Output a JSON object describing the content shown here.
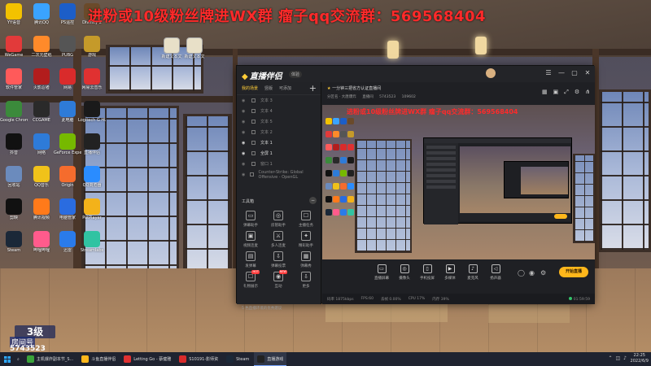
{
  "overlay_text": "进粉或10级粉丝牌进WX群  瘤子qq交流群：569568404",
  "fan_badge": {
    "level": "3级",
    "room_label": "房间号",
    "room_id": "5743523"
  },
  "desktop_icons": [
    {
      "label": "YY语音",
      "color": "#f3c200"
    },
    {
      "label": "腾讯QQ",
      "color": "#3aa3ff"
    },
    {
      "label": "PS遥控",
      "color": "#1c5ec8"
    },
    {
      "label": "Divinity 2",
      "color": "#6a4a2a"
    },
    {
      "label": "WeGame",
      "color": "#e23a3a"
    },
    {
      "label": "二次元壁纸",
      "color": "#ff8a2a"
    },
    {
      "label": "PUBG",
      "color": "#555"
    },
    {
      "label": "游戏",
      "color": "#c59a2a"
    },
    {
      "label": "软件管家",
      "color": "#ff5a5a"
    },
    {
      "label": "火影忍者",
      "color": "#b21d1d"
    },
    {
      "label": "网易",
      "color": "#d92b2b"
    },
    {
      "label": "网易云音乐",
      "color": "#e03131"
    },
    {
      "label": "Google Chrome",
      "color": "#3b8a3b"
    },
    {
      "label": "CCGAME",
      "color": "#2a2a2a"
    },
    {
      "label": "此电脑",
      "color": "#2e7bd8"
    },
    {
      "label": "Logitech G HUB",
      "color": "#1a1a1a"
    },
    {
      "label": "抖音",
      "color": "#111"
    },
    {
      "label": "网络",
      "color": "#2e7bd8"
    },
    {
      "label": "GeForce Experience",
      "color": "#76b900"
    },
    {
      "label": "直播伴侣",
      "color": "#222"
    },
    {
      "label": "回收站",
      "color": "#6b8bbd"
    },
    {
      "label": "QQ音乐",
      "color": "#f0c21a"
    },
    {
      "label": "Origin",
      "color": "#f56c2d"
    },
    {
      "label": "QQ浏览器",
      "color": "#2a8cff"
    },
    {
      "label": "剪映",
      "color": "#111"
    },
    {
      "label": "腾讯视频",
      "color": "#ff7a1a"
    },
    {
      "label": "电脑管家",
      "color": "#2a6ce0"
    },
    {
      "label": "PotPlayer",
      "color": "#f3b21a"
    },
    {
      "label": "Steam",
      "color": "#1b2838"
    },
    {
      "label": "哔哩哔哩",
      "color": "#ff5b8c"
    },
    {
      "label": "迅雷",
      "color": "#2a7bea"
    },
    {
      "label": "Streamlabs",
      "color": "#31c3a2"
    }
  ],
  "desktop_files": [
    "新建文本文",
    "新建文本文"
  ],
  "app": {
    "name": "直播伴侣",
    "version_badge": "体验",
    "window_controls": [
      "☰",
      "—",
      "▢",
      "✕"
    ],
    "scene_tabs": [
      "我的场景",
      "竖版",
      "可添加"
    ],
    "scenes": [
      {
        "name": "文本 3",
        "visible": false
      },
      {
        "name": "文本 4",
        "visible": false
      },
      {
        "name": "文本 5",
        "visible": false
      },
      {
        "name": "文本 2",
        "visible": false
      },
      {
        "name": "文本 1",
        "visible": true
      },
      {
        "name": "全屏 1",
        "visible": true
      },
      {
        "name": "窗口 1",
        "visible": false
      },
      {
        "name": "Counter-Strike: Global Offensive - OpenGL",
        "visible": false
      }
    ],
    "toolbox_label": "工具箱",
    "tools": [
      {
        "label": "弹幕助手",
        "icon": "▭"
      },
      {
        "label": "房管助手",
        "icon": "◎"
      },
      {
        "label": "主播任务",
        "icon": "☐"
      },
      {
        "label": "视频连麦",
        "icon": "▣"
      },
      {
        "label": "多人连麦",
        "icon": "⚔"
      },
      {
        "label": "精彩助手",
        "icon": "✦"
      },
      {
        "label": "发弹幕",
        "icon": "▤"
      },
      {
        "label": "弹幕投票",
        "icon": "⇩"
      },
      {
        "label": "弹幕秀",
        "icon": "▦"
      },
      {
        "label": "礼物展示",
        "icon": "☐",
        "hot": "HOT"
      },
      {
        "label": "互动",
        "icon": "◉",
        "hot": "NEW"
      },
      {
        "label": "更多",
        "icon": "⇩"
      }
    ],
    "notice": "5 色直播环境的优秀建议",
    "stream_title": "一分钟三把省方认证直播间",
    "stream_meta": [
      "分区名 · 大唐爆炸",
      "直播间",
      "5743523",
      "109602"
    ],
    "preview_overlay": "进粉或10级粉丝牌进WX群  瘤子qq交流群：569568404",
    "controls": [
      {
        "label": "直播屏幕",
        "icon": "▭"
      },
      {
        "label": "摄像头",
        "icon": "◎"
      },
      {
        "label": "手机投屏",
        "icon": "▯"
      },
      {
        "label": "多媒体",
        "icon": "▶"
      },
      {
        "label": "麦克风",
        "icon": "♪"
      },
      {
        "label": "扬声器",
        "icon": "◁"
      }
    ],
    "go_live_label": "开始直播",
    "status": [
      "码率 1875kbps",
      "FPS:60",
      "丢帧 0.00%",
      "CPU 17%",
      "内存 39%"
    ],
    "timer": "01:59:59"
  },
  "taskbar": {
    "items": [
      {
        "label": "主机爆炸副本节_S...",
        "color": "#3aa33a",
        "active": false
      },
      {
        "label": "斗鱼直播伴侣",
        "color": "#ffb71b",
        "active": false
      },
      {
        "label": "Letting Go - 蔡健雅",
        "color": "#e03131",
        "active": false
      },
      {
        "label": "S10191-影师资",
        "color": "#d92b2b",
        "active": false
      },
      {
        "label": "Steam",
        "color": "#1b2838",
        "active": false
      },
      {
        "label": "直播游戏",
        "color": "#222",
        "active": true
      }
    ],
    "time": "22:25",
    "date": "2022/6/9"
  }
}
